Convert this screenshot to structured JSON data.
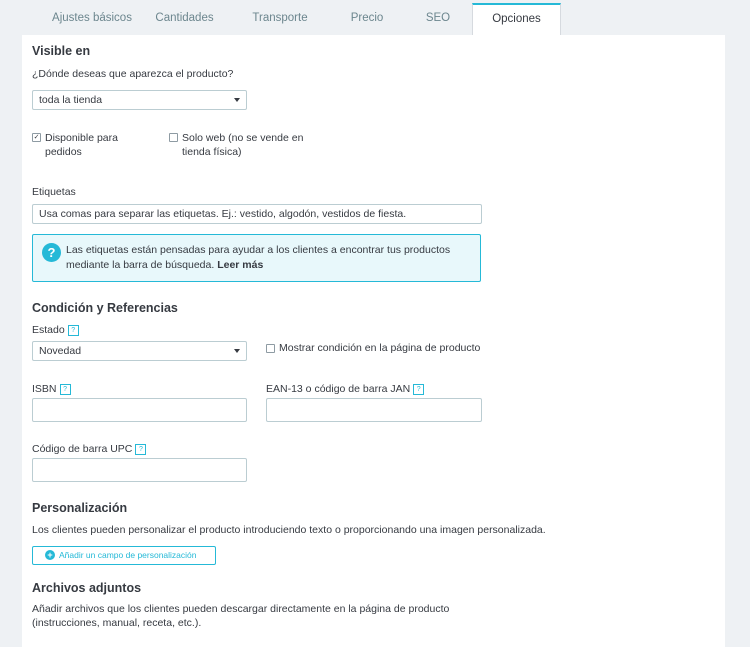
{
  "tabs": [
    {
      "label": "Ajustes básicos",
      "active": false
    },
    {
      "label": "Cantidades",
      "active": false
    },
    {
      "label": "Transporte",
      "active": false
    },
    {
      "label": "Precio",
      "active": false
    },
    {
      "label": "SEO",
      "active": false
    },
    {
      "label": "Opciones",
      "active": true
    }
  ],
  "visibility": {
    "heading": "Visible en",
    "question": "¿Dónde deseas que aparezca el producto?",
    "selected": "toda la tienda",
    "available_line1": "Disponible para",
    "available_line2": "pedidos",
    "available_checked": true,
    "web_only_line1": "Solo web (no se vende en",
    "web_only_line2": "tienda física)",
    "web_only_checked": false
  },
  "tags": {
    "label": "Etiquetas",
    "placeholder": "Usa comas para separar las etiquetas. Ej.: vestido, algodón, vestidos de fiesta.",
    "help_text": "Las etiquetas están pensadas para ayudar a los clientes a encontrar tus productos mediante la barra de búsqueda.",
    "help_link": "Leer más"
  },
  "condition": {
    "heading": "Condición y Referencias",
    "state_label": "Estado",
    "state_selected": "Novedad",
    "show_condition_label": "Mostrar condición en la página de producto",
    "isbn_label": "ISBN",
    "ean_label": "EAN-13 o código de barra JAN",
    "upc_label": "Código de barra UPC",
    "help_glyph": "?"
  },
  "customization": {
    "heading": "Personalización",
    "description": "Los clientes pueden personalizar el producto introduciendo texto o proporcionando una imagen personalizada.",
    "add_button": "Añadir un campo de personalización"
  },
  "attachments": {
    "heading": "Archivos adjuntos",
    "description_line1": "Añadir archivos que los clientes pueden descargar directamente en la página de producto",
    "description_line2": "(instrucciones, manual, receta, etc.)."
  },
  "colors": {
    "accent": "#25b9d7",
    "text": "#363a41",
    "muted": "#6c868e",
    "alert_bg": "#e8f8fb"
  }
}
